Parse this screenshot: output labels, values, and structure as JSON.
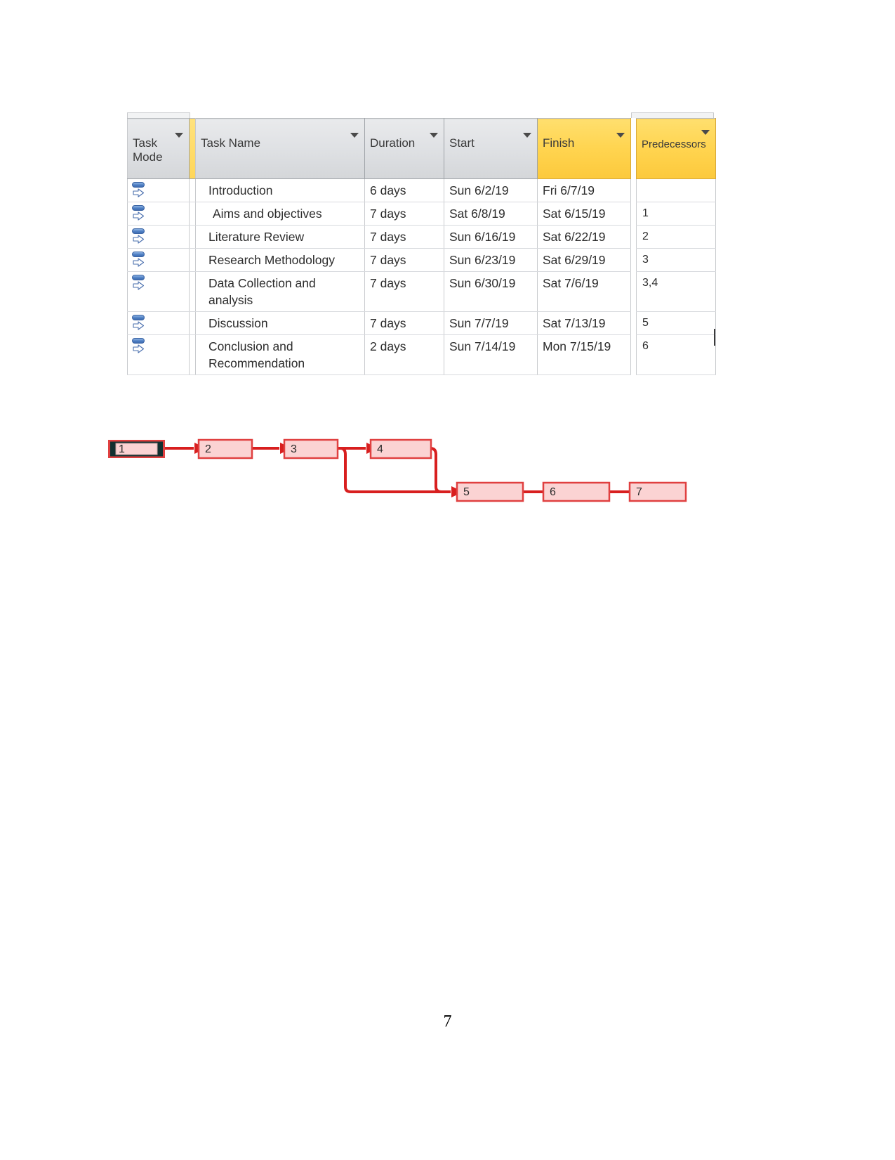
{
  "grid": {
    "columns": [
      {
        "key": "task_mode",
        "label": "Task\nMode",
        "highlight": false
      },
      {
        "key": "indicator",
        "label": "",
        "highlight": true
      },
      {
        "key": "task_name",
        "label": "Task Name",
        "highlight": false
      },
      {
        "key": "duration",
        "label": "Duration",
        "highlight": false
      },
      {
        "key": "start",
        "label": "Start",
        "highlight": false
      },
      {
        "key": "finish",
        "label": "Finish",
        "highlight": true
      },
      {
        "key": "predecessors",
        "label": "Predecessors",
        "highlight": true
      }
    ],
    "rows": [
      {
        "task_mode_icon": "manually-scheduled-icon",
        "task_name": "Introduction",
        "duration": "6 days",
        "start": "Sun 6/2/19",
        "finish": "Fri 6/7/19",
        "predecessors": ""
      },
      {
        "task_mode_icon": "manually-scheduled-icon",
        "task_name": "Aims and objectives",
        "duration": "7 days",
        "start": "Sat 6/8/19",
        "finish": "Sat 6/15/19",
        "predecessors": "1"
      },
      {
        "task_mode_icon": "manually-scheduled-icon",
        "task_name": "Literature Review",
        "duration": "7 days",
        "start": "Sun 6/16/19",
        "finish": "Sat 6/22/19",
        "predecessors": "2"
      },
      {
        "task_mode_icon": "manually-scheduled-icon",
        "task_name": "Research Methodology",
        "duration": "7 days",
        "start": "Sun 6/23/19",
        "finish": "Sat 6/29/19",
        "predecessors": "3"
      },
      {
        "task_mode_icon": "manually-scheduled-icon",
        "task_name": "Data Collection and analysis",
        "duration": "7 days",
        "start": "Sun 6/30/19",
        "finish": "Sat 7/6/19",
        "predecessors": "3,4"
      },
      {
        "task_mode_icon": "manually-scheduled-icon",
        "task_name": "Discussion",
        "duration": "7 days",
        "start": "Sun 7/7/19",
        "finish": "Sat 7/13/19",
        "predecessors": "5"
      },
      {
        "task_mode_icon": "manually-scheduled-icon",
        "task_name": "Conclusion and Recommendation",
        "duration": "2 days",
        "start": "Sun 7/14/19",
        "finish": "Mon 7/15/19",
        "predecessors": "6"
      }
    ]
  },
  "network_diagram": {
    "nodes": [
      {
        "id": "1",
        "label": "1",
        "selected": true
      },
      {
        "id": "2",
        "label": "2",
        "selected": false
      },
      {
        "id": "3",
        "label": "3",
        "selected": false
      },
      {
        "id": "4",
        "label": "4",
        "selected": false
      },
      {
        "id": "5",
        "label": "5",
        "selected": false
      },
      {
        "id": "6",
        "label": "6",
        "selected": false
      },
      {
        "id": "7",
        "label": "7",
        "selected": false
      }
    ],
    "links": [
      {
        "from": "1",
        "to": "2"
      },
      {
        "from": "2",
        "to": "3"
      },
      {
        "from": "3",
        "to": "4"
      },
      {
        "from": "3",
        "to": "5"
      },
      {
        "from": "4",
        "to": "5"
      },
      {
        "from": "5",
        "to": "6"
      },
      {
        "from": "6",
        "to": "7"
      }
    ],
    "colors": {
      "node_fill": "#fbd3d3",
      "node_border": "#e04040",
      "link": "#d81f1f",
      "selected_border": "#123030"
    }
  },
  "footer": {
    "page_number": "7"
  }
}
